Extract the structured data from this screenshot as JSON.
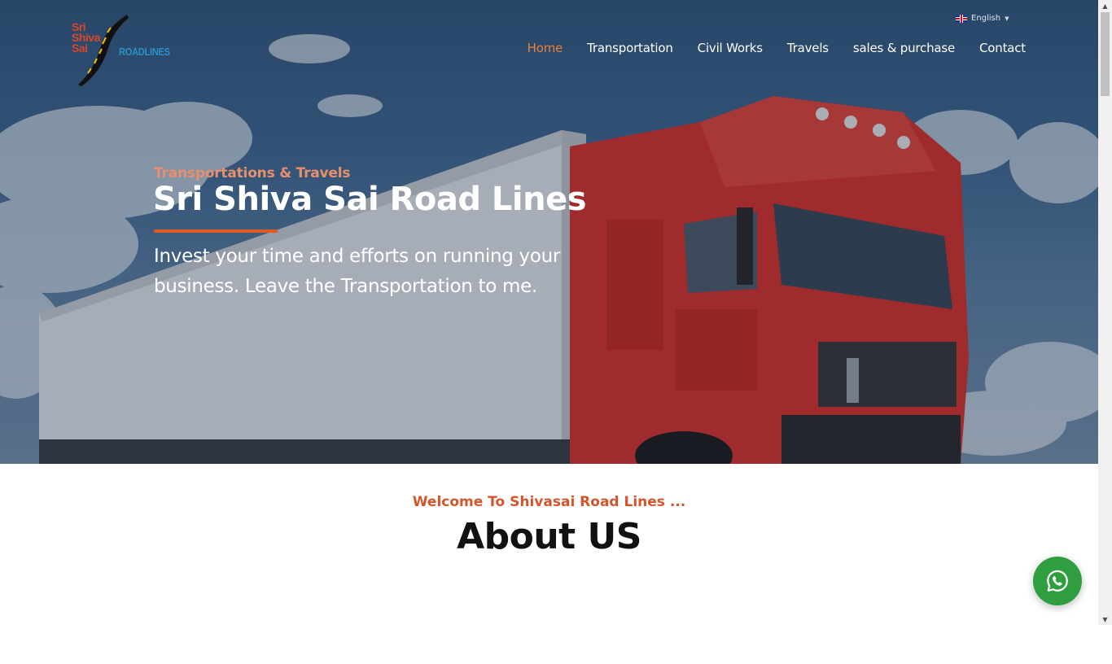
{
  "brand": {
    "logo_lines": [
      "Sri",
      "Shiva",
      "Sai"
    ],
    "logo_road": "ROADLINES",
    "colors": {
      "accent": "#e05a22",
      "logo_red": "#d9462b",
      "logo_blue": "#2a91c7",
      "whatsapp": "#2f9e3f"
    }
  },
  "language": {
    "label": "English",
    "flag": "uk-flag-icon"
  },
  "nav": {
    "items": [
      {
        "label": "Home",
        "active": true
      },
      {
        "label": "Transportation",
        "active": false
      },
      {
        "label": "Civil Works",
        "active": false
      },
      {
        "label": "Travels",
        "active": false
      },
      {
        "label": "sales & purchase",
        "active": false
      },
      {
        "label": "Contact",
        "active": false
      }
    ]
  },
  "hero": {
    "subtitle": "Transportations & Travels",
    "title": "Sri Shiva Sai Road Lines",
    "description": "Invest your time and efforts on running your business. Leave the Transportation to me."
  },
  "about": {
    "kicker": "Welcome To Shivasai Road Lines ...",
    "title": "About US"
  },
  "whatsapp": {
    "icon": "whatsapp-icon"
  }
}
